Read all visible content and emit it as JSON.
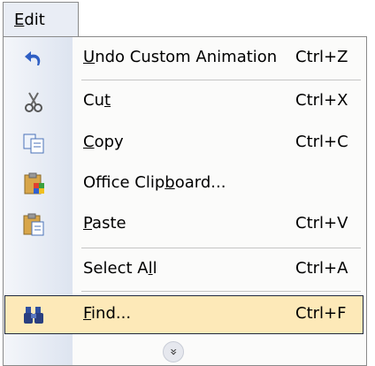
{
  "menubar": {
    "edit_label": "Edit",
    "edit_mnemonic_first": "E",
    "edit_rest": "dit"
  },
  "menu": {
    "items": [
      {
        "pre": "",
        "mn": "U",
        "post": "ndo Custom Animation",
        "shortcut": "Ctrl+Z",
        "icon": "undo-icon"
      },
      {
        "pre": "Cu",
        "mn": "t",
        "post": "",
        "shortcut": "Ctrl+X",
        "icon": "cut-scissors-icon"
      },
      {
        "pre": "",
        "mn": "C",
        "post": "opy",
        "shortcut": "Ctrl+C",
        "icon": "copy-icon"
      },
      {
        "pre": "Office Clip",
        "mn": "b",
        "post": "oard...",
        "shortcut": "",
        "icon": "office-clipboard-icon"
      },
      {
        "pre": "",
        "mn": "P",
        "post": "aste",
        "shortcut": "Ctrl+V",
        "icon": "paste-icon"
      },
      {
        "pre": "Select A",
        "mn": "l",
        "post": "l",
        "shortcut": "Ctrl+A",
        "icon": ""
      },
      {
        "pre": "",
        "mn": "F",
        "post": "ind...",
        "shortcut": "Ctrl+F",
        "icon": "find-binoculars-icon"
      }
    ],
    "expand_glyph": "»",
    "expand_icon": "expand-chevrons-icon"
  },
  "colors": {
    "highlight": "#fde9b8",
    "highlight_border": "#202a3d",
    "gutter": "#dde4f0"
  }
}
